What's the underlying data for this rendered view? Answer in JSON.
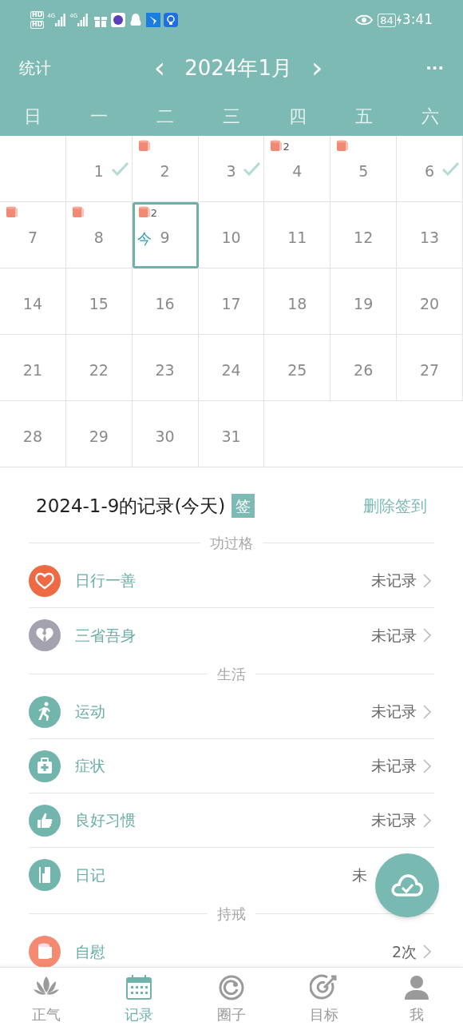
{
  "status_bar": {
    "sim_labels": [
      "HD",
      "HD"
    ],
    "network_labels": [
      "4G",
      "4G"
    ],
    "battery": "84",
    "time": "3:41"
  },
  "header": {
    "left": "统计",
    "prev": "‹",
    "title": "2024年1月",
    "next": "›",
    "more": "···"
  },
  "weekdays": [
    "日",
    "一",
    "二",
    "三",
    "四",
    "五",
    "六"
  ],
  "calendar": [
    [
      {
        "kind": "empty"
      },
      {
        "kind": "day",
        "day": "1",
        "checked": true,
        "roll": false,
        "selected": false
      },
      {
        "kind": "day",
        "day": "2",
        "checked": false,
        "roll": true,
        "selected": false
      },
      {
        "kind": "day",
        "day": "3",
        "checked": true,
        "roll": false,
        "selected": false
      },
      {
        "kind": "day",
        "day": "4",
        "checked": false,
        "roll": true,
        "roll_count": "2",
        "selected": false
      },
      {
        "kind": "day",
        "day": "5",
        "checked": false,
        "roll": true,
        "selected": false
      },
      {
        "kind": "day",
        "day": "6",
        "checked": true,
        "roll": false,
        "selected": false
      }
    ],
    [
      {
        "kind": "day",
        "day": "7",
        "checked": false,
        "roll": true,
        "selected": false
      },
      {
        "kind": "day",
        "day": "8",
        "checked": false,
        "roll": true,
        "selected": false
      },
      {
        "kind": "day",
        "day": "9",
        "checked": false,
        "roll": true,
        "roll_count": "2",
        "today": "今",
        "selected": true
      },
      {
        "kind": "day",
        "day": "10",
        "checked": false,
        "roll": false,
        "selected": false
      },
      {
        "kind": "day",
        "day": "11",
        "checked": false,
        "roll": false,
        "selected": false
      },
      {
        "kind": "day",
        "day": "12",
        "checked": false,
        "roll": false,
        "selected": false
      },
      {
        "kind": "day",
        "day": "13",
        "checked": false,
        "roll": false,
        "selected": false
      }
    ],
    [
      {
        "kind": "day",
        "day": "14",
        "checked": false,
        "roll": false,
        "selected": false
      },
      {
        "kind": "day",
        "day": "15",
        "checked": false,
        "roll": false,
        "selected": false
      },
      {
        "kind": "day",
        "day": "16",
        "checked": false,
        "roll": false,
        "selected": false
      },
      {
        "kind": "day",
        "day": "17",
        "checked": false,
        "roll": false,
        "selected": false
      },
      {
        "kind": "day",
        "day": "18",
        "checked": false,
        "roll": false,
        "selected": false
      },
      {
        "kind": "day",
        "day": "19",
        "checked": false,
        "roll": false,
        "selected": false
      },
      {
        "kind": "day",
        "day": "20",
        "checked": false,
        "roll": false,
        "selected": false
      }
    ],
    [
      {
        "kind": "day",
        "day": "21",
        "checked": false,
        "roll": false,
        "selected": false
      },
      {
        "kind": "day",
        "day": "22",
        "checked": false,
        "roll": false,
        "selected": false
      },
      {
        "kind": "day",
        "day": "23",
        "checked": false,
        "roll": false,
        "selected": false
      },
      {
        "kind": "day",
        "day": "24",
        "checked": false,
        "roll": false,
        "selected": false
      },
      {
        "kind": "day",
        "day": "25",
        "checked": false,
        "roll": false,
        "selected": false
      },
      {
        "kind": "day",
        "day": "26",
        "checked": false,
        "roll": false,
        "selected": false
      },
      {
        "kind": "day",
        "day": "27",
        "checked": false,
        "roll": false,
        "selected": false
      }
    ],
    [
      {
        "kind": "day",
        "day": "28",
        "checked": false,
        "roll": false,
        "selected": false
      },
      {
        "kind": "day",
        "day": "29",
        "checked": false,
        "roll": false,
        "selected": false
      },
      {
        "kind": "day",
        "day": "30",
        "checked": false,
        "roll": false,
        "selected": false
      },
      {
        "kind": "day",
        "day": "31",
        "checked": false,
        "roll": false,
        "selected": false
      },
      {
        "kind": "empty"
      },
      {
        "kind": "empty"
      },
      {
        "kind": "empty"
      }
    ]
  ],
  "record": {
    "title": "2024-1-9的记录(今天)",
    "badge": "签",
    "action": "删除签到"
  },
  "sections": [
    {
      "title": "功过格",
      "items": [
        {
          "label": "日行一善",
          "value": "未记录",
          "color": "#ee6a45",
          "chevron": true
        },
        {
          "label": "三省吾身",
          "value": "未记录",
          "color": "#a3a2ae",
          "chevron": true
        }
      ]
    },
    {
      "title": "生活",
      "items": [
        {
          "label": "运动",
          "value": "未记录",
          "color": "#72b5ad",
          "chevron": true
        },
        {
          "label": "症状",
          "value": "未记录",
          "color": "#72b5ad",
          "chevron": true
        },
        {
          "label": "良好习惯",
          "value": "未记录",
          "color": "#72b5ad",
          "chevron": true
        },
        {
          "label": "日记",
          "value": "未",
          "color": "#72b5ad",
          "chevron": false
        }
      ]
    },
    {
      "title": "持戒",
      "items": [
        {
          "label": "自慰",
          "value": "2次",
          "color": "#f58a72",
          "chevron": true
        }
      ]
    }
  ],
  "nav": [
    {
      "label": "正气",
      "selected": false
    },
    {
      "label": "记录",
      "selected": true
    },
    {
      "label": "圈子",
      "selected": false
    },
    {
      "label": "目标",
      "selected": false
    },
    {
      "label": "我",
      "selected": false
    }
  ]
}
